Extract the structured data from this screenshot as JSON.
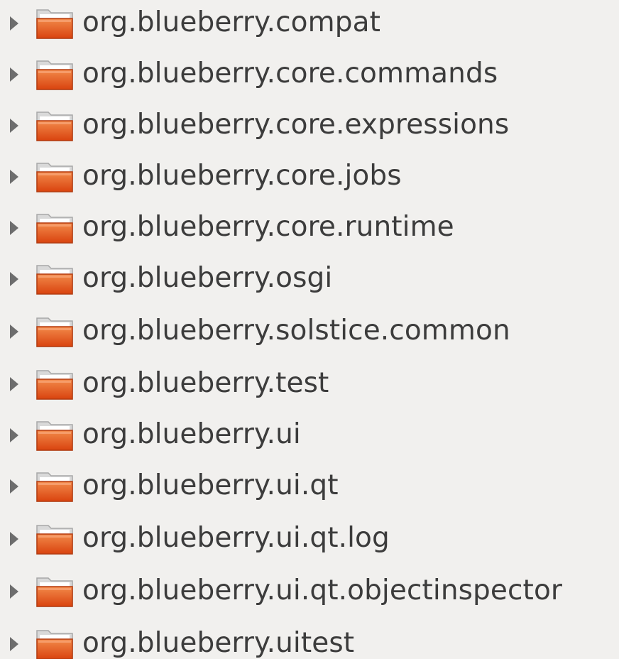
{
  "tree": {
    "items": [
      {
        "label": "org.blueberry.compat",
        "icon": "folder-icon",
        "expander": "collapsed"
      },
      {
        "label": "org.blueberry.core.commands",
        "icon": "folder-icon",
        "expander": "collapsed"
      },
      {
        "label": "org.blueberry.core.expressions",
        "icon": "folder-icon",
        "expander": "collapsed"
      },
      {
        "label": "org.blueberry.core.jobs",
        "icon": "folder-icon",
        "expander": "collapsed"
      },
      {
        "label": "org.blueberry.core.runtime",
        "icon": "folder-icon",
        "expander": "collapsed"
      },
      {
        "label": "org.blueberry.osgi",
        "icon": "folder-icon",
        "expander": "collapsed"
      },
      {
        "label": "org.blueberry.solstice.common",
        "icon": "folder-icon",
        "expander": "collapsed"
      },
      {
        "label": "org.blueberry.test",
        "icon": "folder-icon",
        "expander": "collapsed"
      },
      {
        "label": "org.blueberry.ui",
        "icon": "folder-icon",
        "expander": "collapsed"
      },
      {
        "label": "org.blueberry.ui.qt",
        "icon": "folder-icon",
        "expander": "collapsed"
      },
      {
        "label": "org.blueberry.ui.qt.log",
        "icon": "folder-icon",
        "expander": "collapsed"
      },
      {
        "label": "org.blueberry.ui.qt.objectinspector",
        "icon": "folder-icon",
        "expander": "collapsed"
      },
      {
        "label": "org.blueberry.uitest",
        "icon": "folder-icon",
        "expander": "collapsed"
      }
    ]
  },
  "colors": {
    "background": "#f1f0ee",
    "text": "#3c3c3c",
    "folder_orange": "#e25a1d",
    "expander": "#6d6d6d"
  }
}
